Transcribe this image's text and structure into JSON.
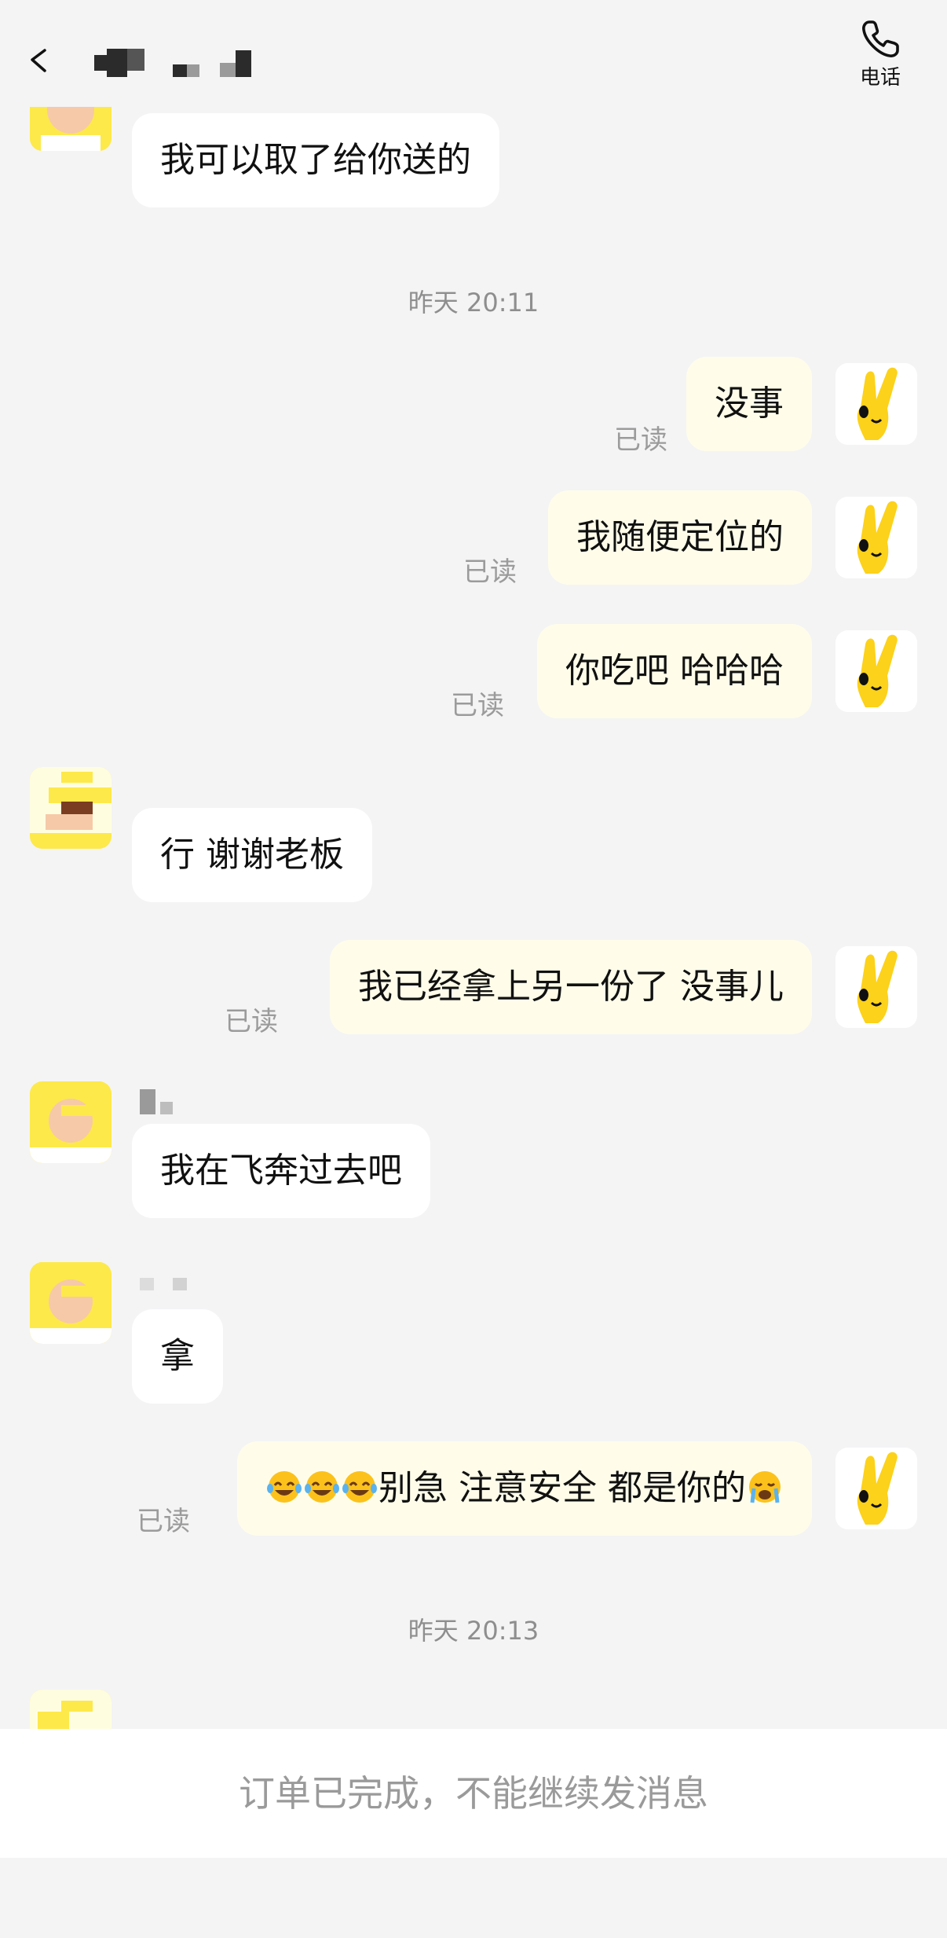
{
  "header": {
    "phone_label": "电话"
  },
  "messages": [
    {
      "dir": "in",
      "text": "我可以取了给你送的"
    },
    {
      "dir": "out",
      "text": "没事",
      "status": "已读"
    },
    {
      "dir": "out",
      "text": "我随便定位的",
      "status": "已读"
    },
    {
      "dir": "out",
      "text": "你吃吧 哈哈哈",
      "status": "已读"
    },
    {
      "dir": "in",
      "text": "行 谢谢老板"
    },
    {
      "dir": "out",
      "text": "我已经拿上另一份了 没事儿",
      "status": "已读"
    },
    {
      "dir": "in",
      "text": "我在飞奔过去吧"
    },
    {
      "dir": "in",
      "text": "拿"
    },
    {
      "dir": "out",
      "text": "别急 注意安全 都是你的",
      "status": "已读",
      "emoji_before": [
        "laughing-crying-emoji",
        "laughing-crying-emoji",
        "laughing-crying-emoji"
      ],
      "emoji_after": [
        "crying-emoji"
      ]
    }
  ],
  "timestamps": [
    "昨天 20:11",
    "昨天 20:13"
  ],
  "footer": {
    "notice": "订单已完成，不能继续发消息"
  },
  "colors": {
    "accent_yellow": "#fde94a",
    "outgoing_bubble": "#fffdea",
    "incoming_bubble": "#ffffff",
    "background": "#f4f4f5"
  }
}
